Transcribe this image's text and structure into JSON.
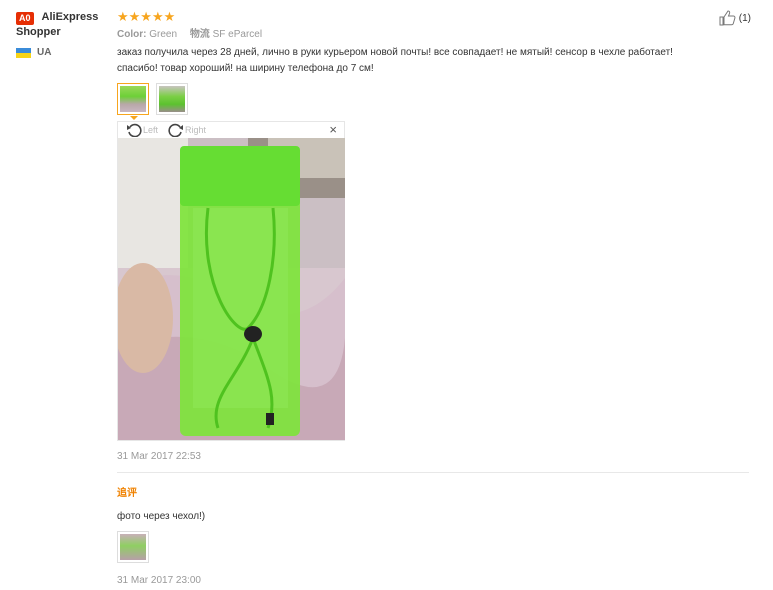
{
  "reviewer": {
    "badge": "A0",
    "name_line1": "AliExpress",
    "name_line2": "Shopper",
    "country": "UA"
  },
  "review": {
    "stars": "★★★★★",
    "rating": 5,
    "color_label": "Color:",
    "color_value": "Green",
    "shipping_label": "物流",
    "shipping_value": "SF eParcel",
    "text_line1": "заказ получила через 28 дней, лично в руки курьером новой почты! все совпадает! не мятый! сенсор в чехле работает!",
    "text_line2": "спасибо! товар хороший! на ширину телефона до 7 см!",
    "date": "31 Mar 2017 22:53",
    "helpful_count": "(1)"
  },
  "viewer": {
    "rotate_left": "Left",
    "rotate_right": "Right",
    "close": "×"
  },
  "followup": {
    "label": "追评",
    "text": "фото через чехол!)",
    "date": "31 Mar 2017 23:00"
  },
  "colors": {
    "accent": "#f7a51e",
    "followup": "#f08200",
    "product_green": "#66dd33"
  }
}
